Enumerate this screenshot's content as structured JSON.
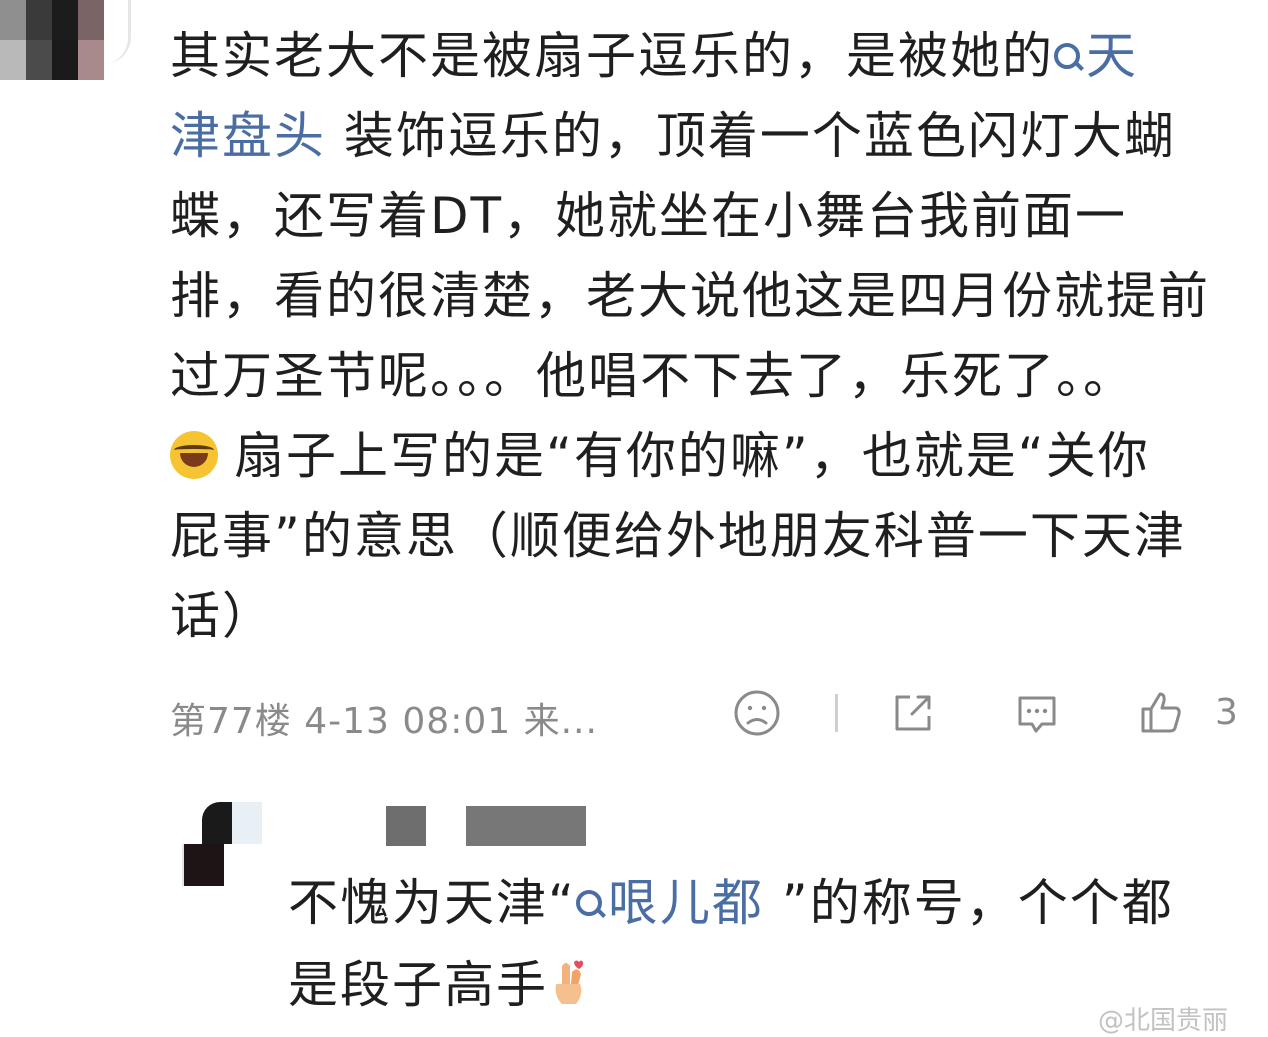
{
  "comment": {
    "line1": "其实老大不是被扇子逗乐的，是被她的",
    "topic1_a": "天",
    "topic1_b": "津盘头",
    "line2_rest": " 装饰逗乐的，顶着一个蓝色闪灯大蝴",
    "line3": "蝶，还写着DT，她就坐在小舞台我前面一",
    "line4": "排，看的很清楚，老大说他这是四月份就提前",
    "line5": "过万圣节呢。。。他唱不下去了，乐死了。。",
    "line6": "扇子上写的是“有你的嘛”，也就是“关你",
    "line7": "屁事”的意思（顺便给外地朋友科普一下天津",
    "line8": "话）",
    "emoji_name": "laughing-tears-emoji"
  },
  "meta": {
    "floor_time": "第77楼  4-13 08:01  来...",
    "like_count": "3",
    "icons": [
      "sad-face-icon",
      "share-icon",
      "comment-icon",
      "thumbs-up-icon"
    ]
  },
  "reply": {
    "text_before": "不愧为天津“",
    "topic": "哏儿都",
    "text_after": " ”的称号，个个都",
    "line2": "是段子高手",
    "emoji_name": "hand-heart-emoji"
  },
  "watermark": "@北国贵丽"
}
